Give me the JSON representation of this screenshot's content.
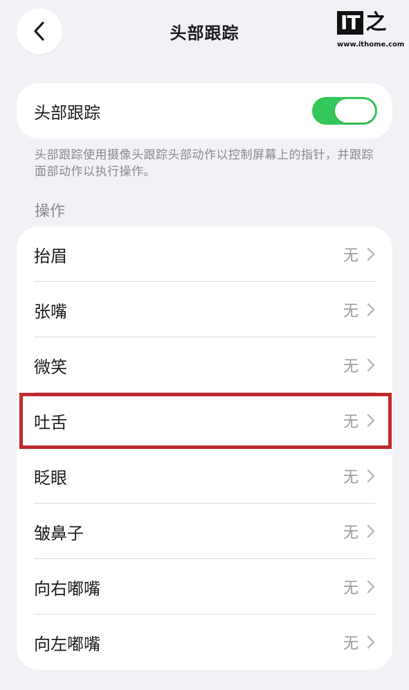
{
  "nav": {
    "title": "头部跟踪",
    "back_icon": "chevron-left-icon"
  },
  "watermark": {
    "logo_text": "IT",
    "logo_char": "之家",
    "url": "www.ithome.com"
  },
  "head_tracking": {
    "label": "头部跟踪",
    "enabled": true,
    "description": "头部跟踪使用摄像头跟踪头部动作以控制屏幕上的指针，并跟踪面部动作以执行操作。"
  },
  "actions": {
    "header": "操作",
    "items": [
      {
        "label": "抬眉",
        "value": "无"
      },
      {
        "label": "张嘴",
        "value": "无"
      },
      {
        "label": "微笑",
        "value": "无"
      },
      {
        "label": "吐舌",
        "value": "无"
      },
      {
        "label": "眨眼",
        "value": "无"
      },
      {
        "label": "皱鼻子",
        "value": "无"
      },
      {
        "label": "向右嘟嘴",
        "value": "无"
      },
      {
        "label": "向左嘟嘴",
        "value": "无"
      }
    ]
  },
  "colors": {
    "background": "#f2f1f6",
    "toggle_on": "#34c759",
    "highlight": "#c0282d"
  }
}
